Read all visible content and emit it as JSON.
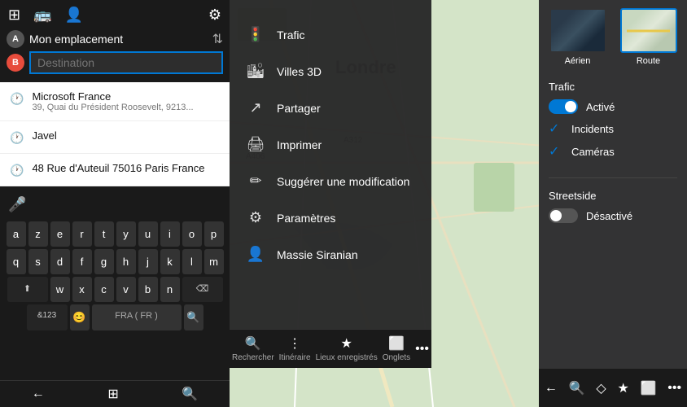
{
  "panel1": {
    "top_icons": [
      "⊞",
      "≡",
      "👤"
    ],
    "badge_a": "A",
    "badge_b": "B",
    "location_text": "Mon emplacement",
    "destination_placeholder": "Destination",
    "swap_icon": "⇅",
    "suggestions": [
      {
        "name": "Microsoft France",
        "addr": "39, Quai du Président Roosevelt, 9213..."
      },
      {
        "name": "Javel",
        "addr": ""
      },
      {
        "name": "48 Rue d'Auteuil 75016 Paris France",
        "addr": ""
      }
    ],
    "keyboard": {
      "row1": [
        "a",
        "z",
        "e",
        "r",
        "t",
        "y",
        "u",
        "i",
        "o",
        "p"
      ],
      "row2": [
        "q",
        "s",
        "d",
        "f",
        "g",
        "h",
        "j",
        "k",
        "l",
        "m"
      ],
      "row3": [
        "w",
        "x",
        "c",
        "v",
        "b",
        "n"
      ],
      "special_left": "⬆",
      "special_right": "⌫",
      "bottom": {
        "special": "&123",
        "emoji": "😊",
        "lang": "< FRA ( FR ) >",
        "search": "🔍"
      },
      "space": "< FRA ( FR ) >"
    },
    "taskbar": {
      "back": "←",
      "home": "⊞",
      "search": "🔍"
    }
  },
  "panel2": {
    "map_city": "Londre",
    "menu_items": [
      {
        "icon": "🚦",
        "label": "Trafic"
      },
      {
        "icon": "🏙",
        "label": "Villes 3D"
      },
      {
        "icon": "↗",
        "label": "Partager"
      },
      {
        "icon": "🖨",
        "label": "Imprimer"
      },
      {
        "icon": "✏",
        "label": "Suggérer une modification"
      },
      {
        "icon": "⚙",
        "label": "Paramètres"
      },
      {
        "icon": "👤",
        "label": "Massie Siranian"
      }
    ],
    "bottom_bar": [
      {
        "icon": "🔍",
        "label": "Rechercher",
        "active": false
      },
      {
        "icon": "≡",
        "label": "Itinéraire",
        "active": false
      },
      {
        "icon": "★",
        "label": "Lieux enregistrés",
        "active": false
      },
      {
        "icon": "⬜",
        "label": "Onglets",
        "active": true
      },
      {
        "icon": "...",
        "label": "",
        "active": false
      }
    ]
  },
  "panel3": {
    "map_types": [
      {
        "label": "Aérien",
        "selected": false
      },
      {
        "label": "Route",
        "selected": true
      }
    ],
    "trafic_section": {
      "title": "Trafic",
      "toggle_label": "Activé",
      "toggle_on": true,
      "checks": [
        {
          "label": "Incidents",
          "checked": true
        },
        {
          "label": "Caméras",
          "checked": true
        }
      ]
    },
    "streetside_section": {
      "title": "Streetside",
      "toggle_label": "Désactivé",
      "toggle_on": false
    },
    "taskbar": {
      "back": "←",
      "search": "🔍",
      "location": "◇",
      "favorites": "★",
      "windows": "⬜",
      "more": "..."
    }
  }
}
